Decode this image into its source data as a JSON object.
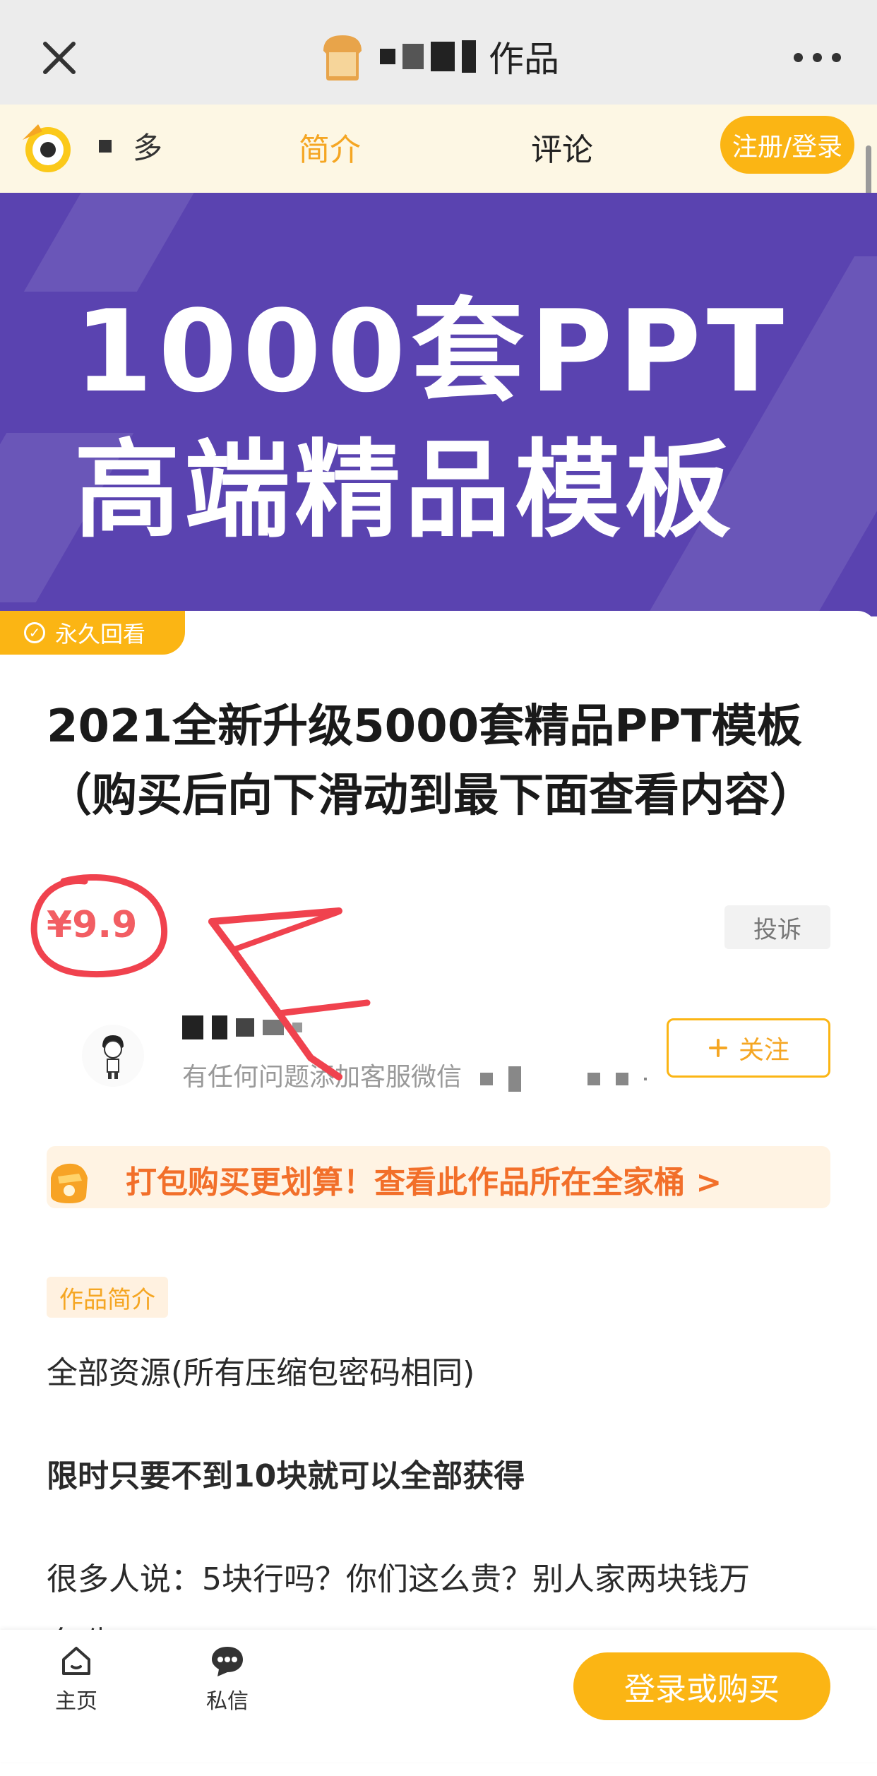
{
  "header": {
    "title": "作品",
    "close_icon": "close-icon",
    "more_icon": "more-icon"
  },
  "nav": {
    "owner_label": "多",
    "tabs": [
      "简介",
      "评论"
    ],
    "login_label": "注册/登录"
  },
  "banner": {
    "line1": "1000套PPT",
    "line2": "高端精品模板",
    "color": "#5a43b0"
  },
  "badge": {
    "label": "永久回看"
  },
  "product": {
    "title": "2021全新升级5000套精品PPT模板（购买后向下滑动到最下面查看内容）",
    "price": "¥9.9",
    "report_label": "投诉"
  },
  "seller": {
    "description": "有任何问题添加客服微信",
    "follow_label": "关注"
  },
  "bundle": {
    "text": "打包购买更划算！查看此作品所在全家桶 >"
  },
  "intro": {
    "tag": "作品简介",
    "paragraphs": [
      "全部资源(所有压缩包密码相同)",
      "限时只要不到10块就可以全部获得",
      "很多人说：5块行吗？你们这么贵？别人家两块钱万",
      "套呦"
    ]
  },
  "bottom": {
    "tabs": [
      {
        "label": "主页",
        "icon": "home-icon"
      },
      {
        "label": "私信",
        "icon": "chat-icon"
      }
    ],
    "buy_label": "登录或购买"
  },
  "colors": {
    "accent": "#fbb514",
    "price": "#f25e63",
    "bundle_text": "#f26f2a",
    "annotation": "#f0424e"
  }
}
